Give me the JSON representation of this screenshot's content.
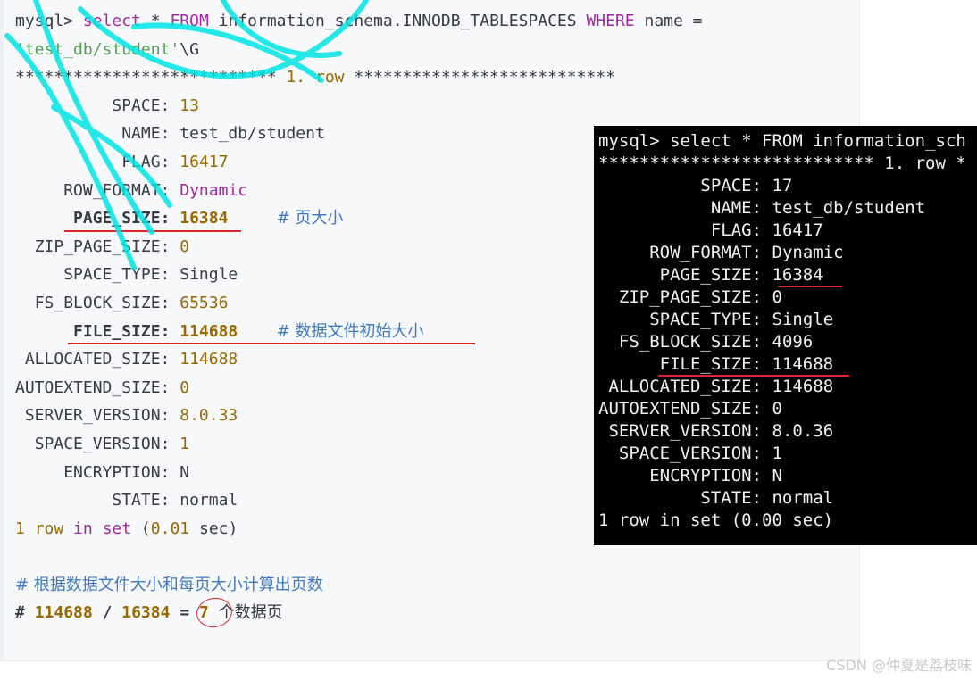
{
  "code_block": {
    "prompt": "mysql>",
    "query_kw1": "select",
    "query_star": "*",
    "query_kw2": "FROM",
    "query_table": "information_schema.INNODB_TABLESPACES",
    "query_kw3": "WHERE",
    "query_col": "name =",
    "query_literal": "'test_db/student'",
    "query_terminator": "\\G",
    "row_stars_left": "***************************",
    "row_number": "1.",
    "row_word": "row",
    "row_stars_right": "***************************",
    "fields": [
      {
        "label": "SPACE:",
        "value": "13"
      },
      {
        "label": "NAME:",
        "value": "test_db/student"
      },
      {
        "label": "FLAG:",
        "value": "16417"
      },
      {
        "label": "ROW_FORMAT:",
        "value": "Dynamic"
      },
      {
        "label": "PAGE_SIZE:",
        "value": "16384",
        "comment": "# 页大小"
      },
      {
        "label": "ZIP_PAGE_SIZE:",
        "value": "0"
      },
      {
        "label": "SPACE_TYPE:",
        "value": "Single"
      },
      {
        "label": "FS_BLOCK_SIZE:",
        "value": "65536"
      },
      {
        "label": "FILE_SIZE:",
        "value": "114688",
        "comment": "# 数据文件初始大小"
      },
      {
        "label": "ALLOCATED_SIZE:",
        "value": "114688"
      },
      {
        "label": "AUTOEXTEND_SIZE:",
        "value": "0"
      },
      {
        "label": "SERVER_VERSION:",
        "value": "8.0.33"
      },
      {
        "label": "SPACE_VERSION:",
        "value": "1"
      },
      {
        "label": "ENCRYPTION:",
        "value": "N"
      },
      {
        "label": "STATE:",
        "value": "normal"
      }
    ],
    "summary_count": "1",
    "summary_row": "row",
    "summary_in": "in",
    "summary_set": "set",
    "summary_time": "0.01",
    "summary_sec": "sec)",
    "comment_calc": "# 根据数据文件大小和每页大小计算出页数",
    "calc_hash": "#",
    "calc_a": "114688",
    "calc_div": "/",
    "calc_b": "16384",
    "calc_eq": "=",
    "calc_result": "7",
    "calc_tail": "个数据页"
  },
  "terminal": {
    "query_line": "mysql> select * FROM information_sch",
    "row_line": "*************************** 1. row *",
    "fields": [
      {
        "label": "SPACE:",
        "value": "17"
      },
      {
        "label": "NAME:",
        "value": "test_db/student"
      },
      {
        "label": "FLAG:",
        "value": "16417"
      },
      {
        "label": "ROW_FORMAT:",
        "value": "Dynamic"
      },
      {
        "label": "PAGE_SIZE:",
        "value": "16384"
      },
      {
        "label": "ZIP_PAGE_SIZE:",
        "value": "0"
      },
      {
        "label": "SPACE_TYPE:",
        "value": "Single"
      },
      {
        "label": "FS_BLOCK_SIZE:",
        "value": "4096"
      },
      {
        "label": "FILE_SIZE:",
        "value": "114688"
      },
      {
        "label": "ALLOCATED_SIZE:",
        "value": "114688"
      },
      {
        "label": "AUTOEXTEND_SIZE:",
        "value": "0"
      },
      {
        "label": "SERVER_VERSION:",
        "value": "8.0.36"
      },
      {
        "label": "SPACE_VERSION:",
        "value": "1"
      },
      {
        "label": "ENCRYPTION:",
        "value": "N"
      },
      {
        "label": "STATE:",
        "value": "normal"
      }
    ],
    "summary": "1 row in set (0.00 sec)"
  },
  "credit": "CSDN @仲夏是荔枝味",
  "colors": {
    "keyword": "#a626a4",
    "string": "#50a14f",
    "number": "#986801",
    "comment": "#4078c0",
    "annotation_red": "#e0262b",
    "watermark": "#00e5e5"
  }
}
